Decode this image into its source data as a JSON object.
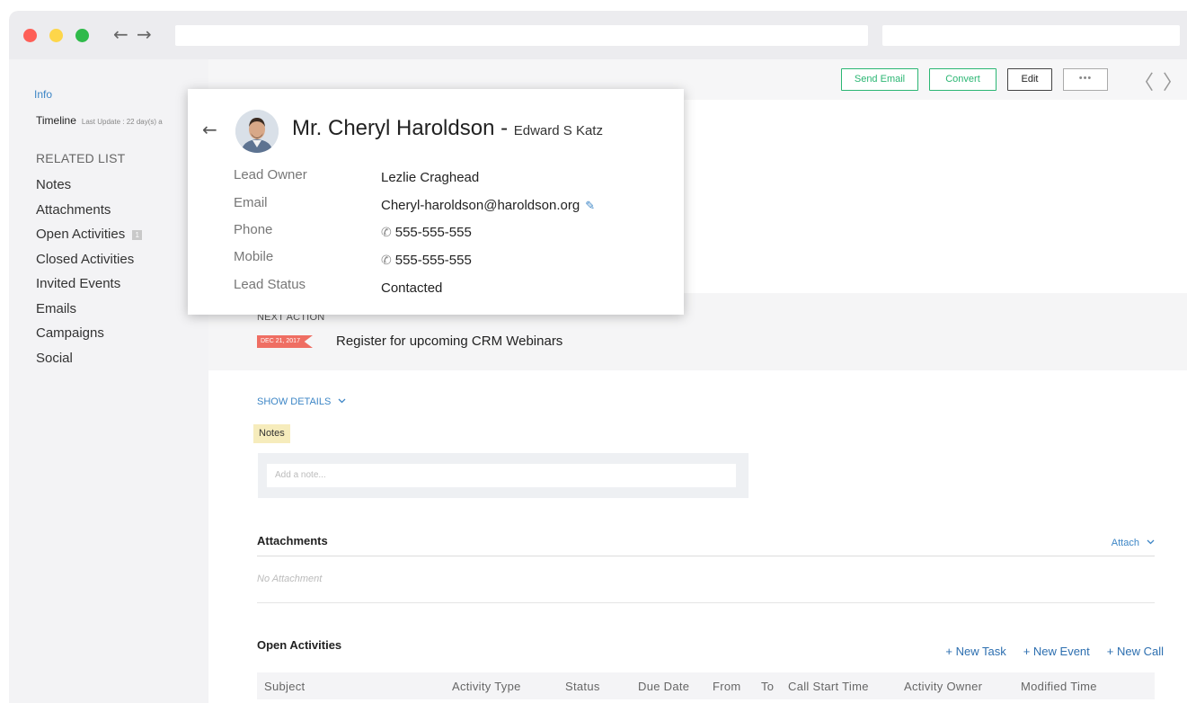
{
  "browser": {
    "back": "←",
    "forward": "→"
  },
  "sidebar": {
    "info": "Info",
    "timeline": "Timeline",
    "last_update": "Last Update : 22 day(s) a",
    "related_heading": "RELATED LIST",
    "items": [
      {
        "label": "Notes",
        "badge": ""
      },
      {
        "label": "Attachments",
        "badge": ""
      },
      {
        "label": "Open Activities",
        "badge": "1"
      },
      {
        "label": "Closed Activities",
        "badge": ""
      },
      {
        "label": "Invited Events",
        "badge": ""
      },
      {
        "label": "Emails",
        "badge": ""
      },
      {
        "label": "Campaigns",
        "badge": ""
      },
      {
        "label": "Social",
        "badge": ""
      }
    ]
  },
  "toolbar": {
    "send_email": "Send Email",
    "convert": "Convert",
    "edit": "Edit",
    "more": "•••",
    "prev": "〈",
    "next": "〉"
  },
  "popup": {
    "back": "←",
    "name": "Mr. Cheryl Haroldson",
    "separator": " - ",
    "company": "Edward S Katz",
    "fields": [
      {
        "label": "Lead Owner",
        "value": "Lezlie Craghead"
      },
      {
        "label": "Email",
        "value": "Cheryl-haroldson@haroldson.org"
      },
      {
        "label": "Phone",
        "value": "555-555-555"
      },
      {
        "label": "Mobile",
        "value": "555-555-555"
      },
      {
        "label": "Lead Status",
        "value": "Contacted"
      }
    ]
  },
  "next_action": {
    "label": "NEXT ACTION",
    "date": "DEC 21, 2017",
    "text": "Register for upcoming CRM Webinars"
  },
  "show_details": "SHOW DETAILS",
  "notes": {
    "tag": "Notes",
    "placeholder": "Add a note..."
  },
  "attachments": {
    "title": "Attachments",
    "attach": "Attach",
    "empty": "No Attachment"
  },
  "open_activities": {
    "title": "Open Activities",
    "new_task": "+ New Task",
    "new_event": "+ New Event",
    "new_call": "+ New Call",
    "columns": [
      "Subject",
      "Activity Type",
      "Status",
      "Due Date",
      "From",
      "To",
      "Call Start Time",
      "Activity Owner",
      "Modified Time"
    ]
  },
  "colors": {
    "accent": "#3d86c6",
    "green": "#2bb673",
    "tag": "#ef6e63"
  }
}
